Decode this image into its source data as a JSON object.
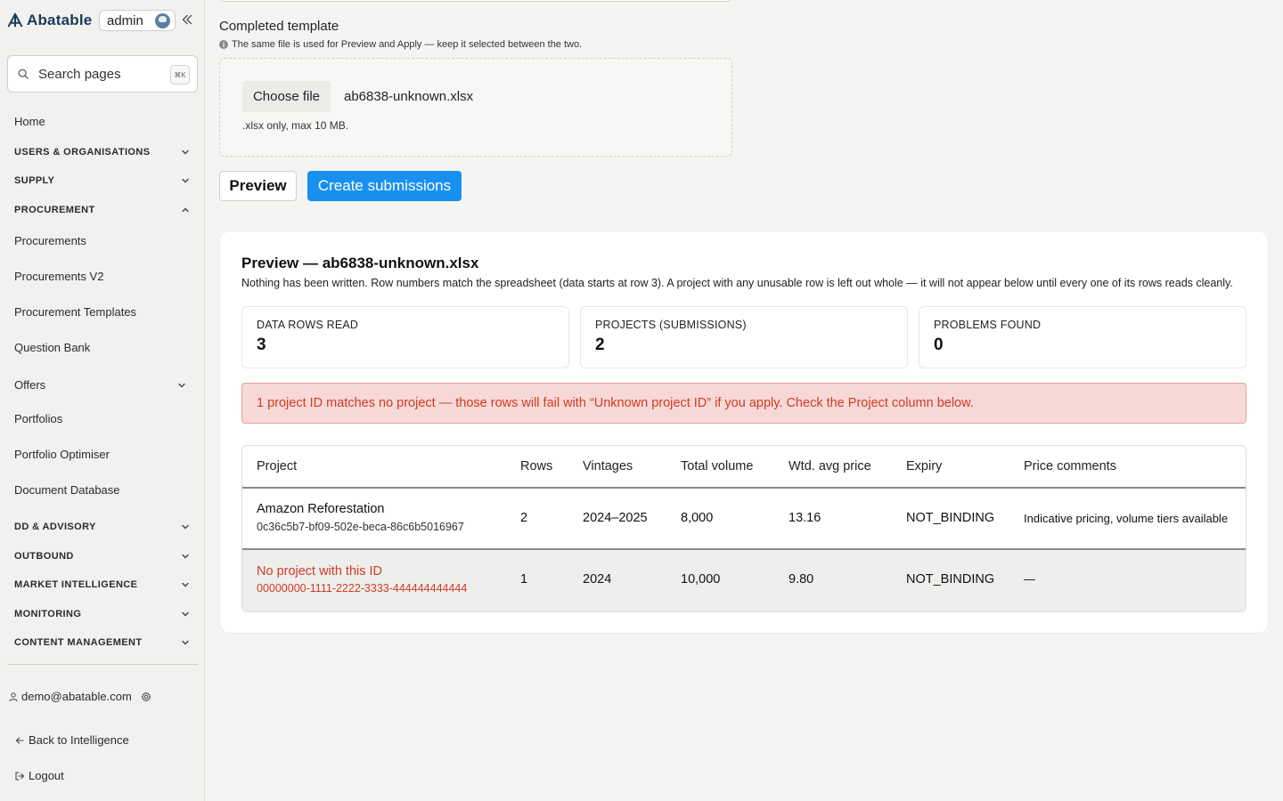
{
  "sidebar": {
    "brand": "Abatable",
    "env": "admin",
    "search": {
      "placeholder": "Search pages",
      "shortcut": "⌘K"
    },
    "home": "Home",
    "sections": {
      "users": "USERS & ORGANISATIONS",
      "supply": "SUPPLY",
      "procurement": "PROCUREMENT",
      "dd": "DD & ADVISORY",
      "outbound": "OUTBOUND",
      "market": "MARKET INTELLIGENCE",
      "monitoring": "MONITORING",
      "content": "CONTENT MANAGEMENT"
    },
    "procurement_items": [
      "Procurements",
      "Procurements V2",
      "Procurement Templates",
      "Question Bank"
    ],
    "offers": "Offers",
    "other_items": [
      "Portfolios",
      "Portfolio Optimiser",
      "Document Database"
    ],
    "user_email": "demo@abatable.com",
    "back_link": "Back to Intelligence",
    "logout": "Logout"
  },
  "upload": {
    "label": "Completed template",
    "help": "The same file is used for Preview and Apply — keep it selected between the two.",
    "choose_button": "Choose file",
    "file_name": "ab6838-unknown.xlsx",
    "hint": ".xlsx only, max 10 MB."
  },
  "actions": {
    "preview": "Preview",
    "create": "Create submissions"
  },
  "preview": {
    "title": "Preview — ab6838-unknown.xlsx",
    "subtitle": "Nothing has been written. Row numbers match the spreadsheet (data starts at row 3). A project with any unusable row is left out whole — it will not appear below until every one of its rows reads cleanly.",
    "stats": [
      {
        "label": "DATA ROWS READ",
        "value": "3"
      },
      {
        "label": "PROJECTS (SUBMISSIONS)",
        "value": "2"
      },
      {
        "label": "PROBLEMS FOUND",
        "value": "0"
      }
    ],
    "alert": "1 project ID matches no project — those rows will fail with “Unknown project ID” if you apply. Check the Project column below.",
    "columns": [
      "Project",
      "Rows",
      "Vintages",
      "Total volume",
      "Wtd. avg price",
      "Expiry",
      "Price comments"
    ],
    "rows": [
      {
        "project": "Amazon Reforestation",
        "id": "0c36c5b7-bf09-502e-beca-86c6b5016967",
        "rows": "2",
        "vintages": "2024–2025",
        "volume": "8,000",
        "price": "13.16",
        "expiry": "NOT_BINDING",
        "comments": "Indicative pricing, volume tiers available"
      },
      {
        "project": "No project with this ID",
        "id": "00000000-1111-2222-3333-444444444444",
        "rows": "1",
        "vintages": "2024",
        "volume": "10,000",
        "price": "9.80",
        "expiry": "NOT_BINDING",
        "comments": "—"
      }
    ]
  },
  "colors": {
    "accent": "#1890f0",
    "error": "#d23a26",
    "error_bg": "#f6d9d6",
    "brand": "#1a3a5a"
  }
}
